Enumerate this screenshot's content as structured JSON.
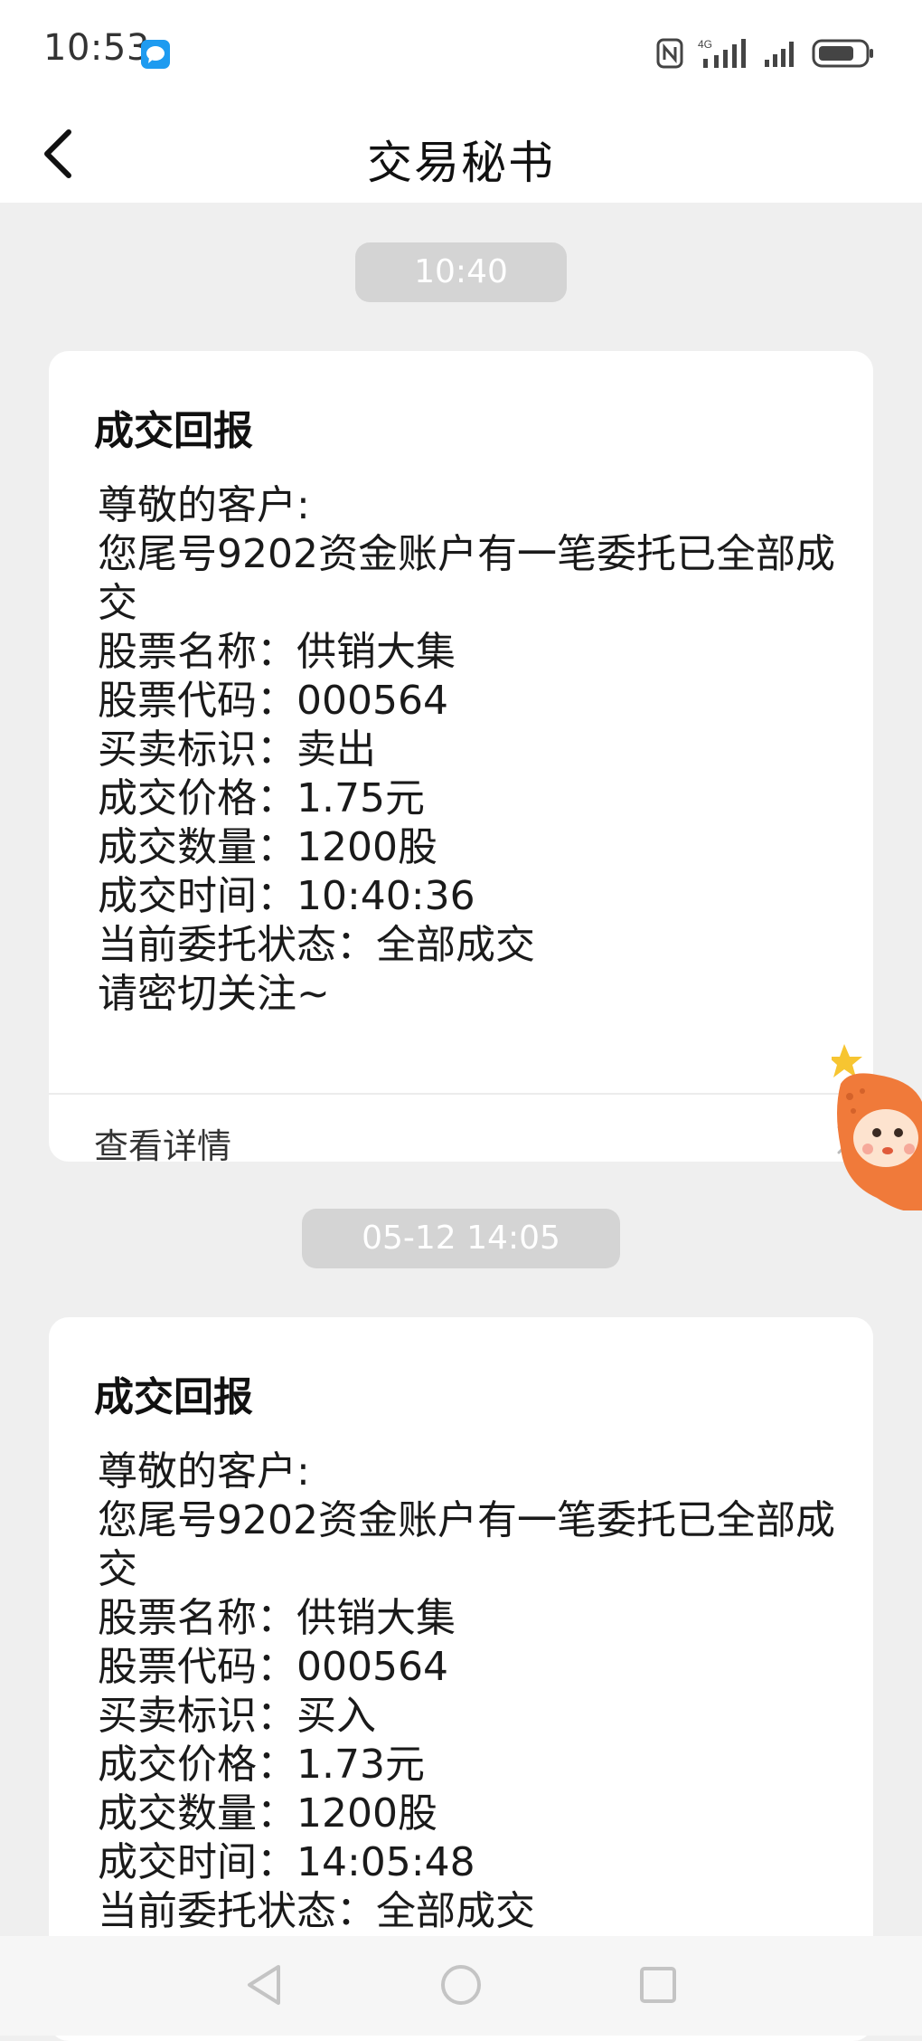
{
  "status_bar": {
    "time": "10:53",
    "network": "4G"
  },
  "header": {
    "title": "交易秘书"
  },
  "messages": [
    {
      "timestamp": "10:40",
      "title": "成交回报",
      "greeting": "尊敬的客户:",
      "notice": "您尾号9202资金账户有一笔委托已全部成交",
      "stock_name": "股票名称：供销大集",
      "stock_code": "股票代码：000564",
      "trade_side": "买卖标识：卖出",
      "price": "成交价格：1.75元",
      "quantity": "成交数量：1200股",
      "time": "成交时间：10:40:36",
      "status": "当前委托状态：全部成交",
      "closing": "请密切关注~",
      "footer_link": "查看详情"
    },
    {
      "timestamp": "05-12 14:05",
      "title": "成交回报",
      "greeting": "尊敬的客户:",
      "notice": "您尾号9202资金账户有一笔委托已全部成交",
      "stock_name": "股票名称：供销大集",
      "stock_code": "股票代码：000564",
      "trade_side": "买卖标识：买入",
      "price": "成交价格：1.73元",
      "quantity": "成交数量：1200股",
      "time": "成交时间：14:05:48",
      "status": "当前委托状态：全部成交"
    }
  ],
  "colors": {
    "background": "#efefef",
    "card": "#ffffff",
    "pill": "#d4d4d4",
    "notification_icon": "#1e9bf0",
    "mascot": "#f07a3a"
  },
  "icons": {
    "back": "chevron-left-icon",
    "footer_arrow": "chevron-right-icon",
    "nav_back": "triangle-back-icon",
    "nav_home": "circle-home-icon",
    "nav_recents": "square-recents-icon"
  }
}
